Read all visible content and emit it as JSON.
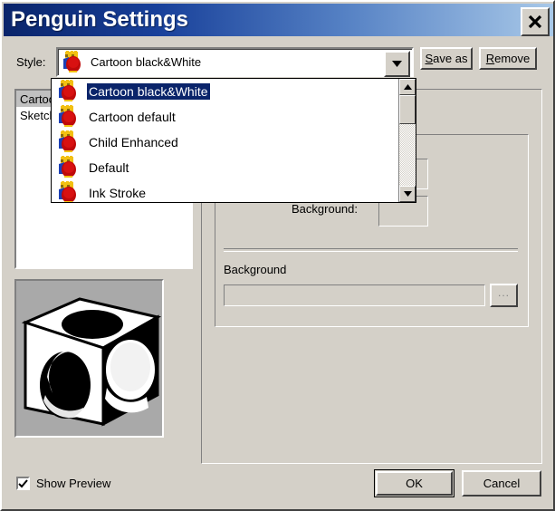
{
  "window": {
    "title": "Penguin Settings",
    "close_label": "✕",
    "titlebar_gradient_start": "#0a246a",
    "titlebar_gradient_end": "#a8c8e8",
    "face_color": "#d4d0c8"
  },
  "style_row": {
    "label": "Style:",
    "selected_value": "Cartoon black&White",
    "save_as_button": {
      "prefix": "",
      "accel": "S",
      "suffix": "ave as"
    },
    "remove_button": {
      "prefix": "",
      "accel": "R",
      "suffix": "emove"
    }
  },
  "dropdown": {
    "open": true,
    "highlight_color": "#0a246a",
    "items": [
      {
        "label": "Cartoon black&White",
        "selected": true
      },
      {
        "label": "Cartoon default",
        "selected": false
      },
      {
        "label": "Child Enhanced",
        "selected": false
      },
      {
        "label": "Default",
        "selected": false
      },
      {
        "label": "Ink Stroke",
        "selected": false
      }
    ],
    "scroll_up_glyph": "▲",
    "scroll_down_glyph": "▼"
  },
  "left_list": {
    "items": [
      {
        "label": "Cartoon",
        "selected": true
      },
      {
        "label": "Sketch",
        "selected": false
      }
    ]
  },
  "preview": {
    "alt": "black and white cube with circular holes"
  },
  "right_panel": {
    "background_color_label": "Background:",
    "background_color_value": "#d4d0c8",
    "background_section_label": "Background",
    "background_path_value": "",
    "browse_button_label": "..."
  },
  "footer": {
    "show_preview_label": "Show Preview",
    "show_preview_checked": true,
    "ok_label": "OK",
    "cancel_label": "Cancel"
  }
}
